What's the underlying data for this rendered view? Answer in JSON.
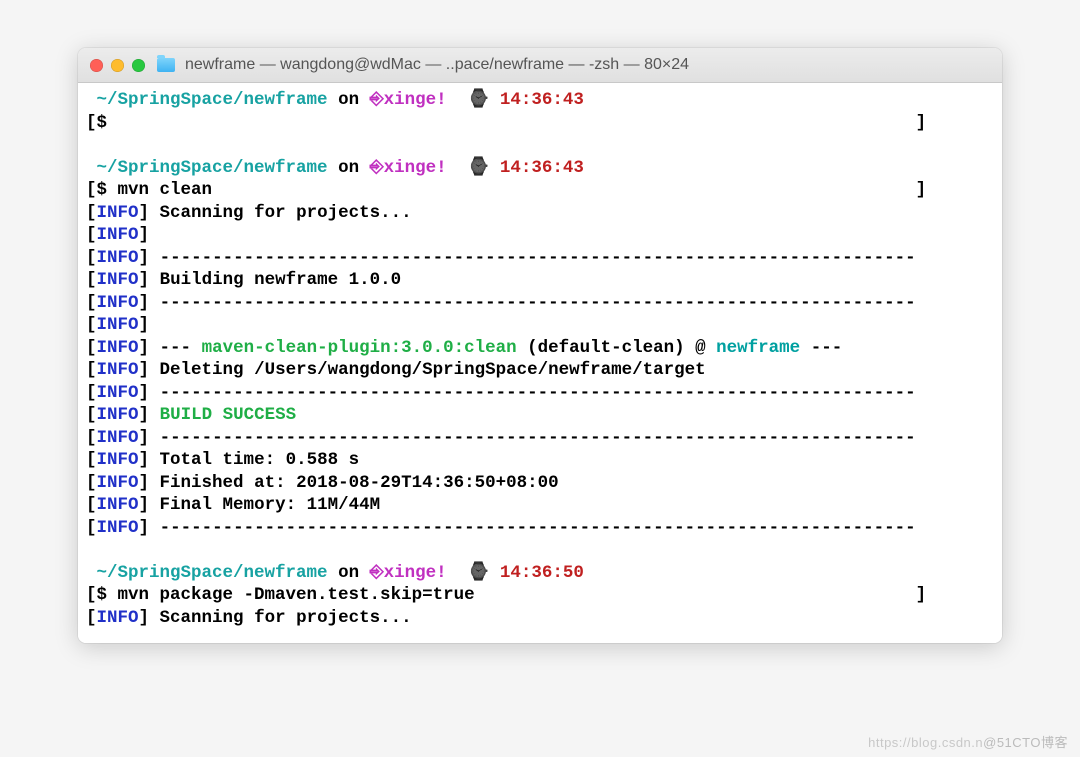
{
  "window": {
    "title": "newframe — wangdong@wdMac — ..pace/newframe — -zsh — 80×24"
  },
  "prompt": {
    "cwd": "~/SpringSpace/newframe",
    "on": " on ",
    "branchBox": "⎆",
    "branch": "xinge!",
    "watch": "⌚",
    "t1": "14:36:43",
    "t2": "14:36:43",
    "t3": "14:36:50"
  },
  "cmd": {
    "ps": "$",
    "empty": "",
    "c1": "$ mvn clean",
    "c2": "$ mvn package -Dmaven.test.skip=true"
  },
  "tok": {
    "lb": "[",
    "rb": "]",
    "info": "INFO",
    "dash": "------------------------------------------------------------------------",
    "scan": " Scanning for projects...",
    "build": "Building newframe 1.0.0",
    "pluginPre": " --- ",
    "plugin": "maven-clean-plugin:3.0.0:clean",
    "goal": " (default-clean) @ ",
    "proj": "newframe",
    "pluginPost": " ---",
    "del": " Deleting /Users/wangdong/SpringSpace/newframe/target",
    "ok": "BUILD SUCCESS",
    "total": " Total time: 0.588 s",
    "finished": " Finished at: 2018-08-29T14:36:50+08:00",
    "mem": " Final Memory: 11M/44M"
  },
  "watermark": {
    "a": "https://blog.csdn.n",
    "b": "@51CTO博客"
  }
}
